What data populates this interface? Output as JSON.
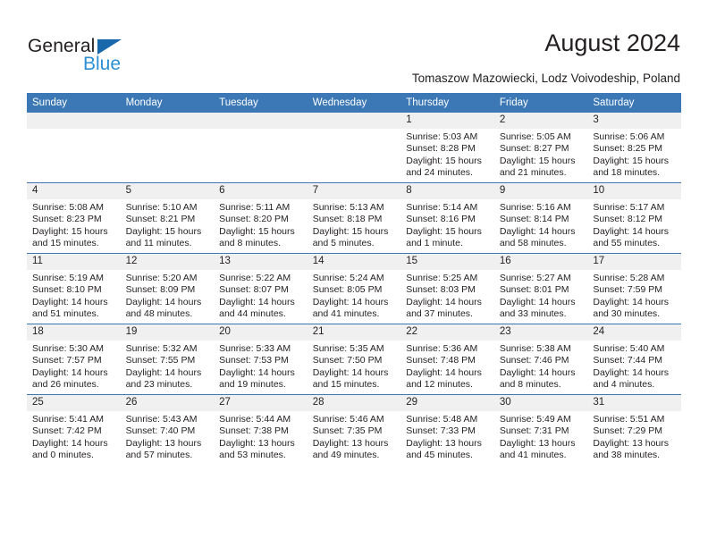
{
  "brand": {
    "name_dark": "General",
    "name_light": "Blue",
    "triangle_color": "#1868ab",
    "light_color": "#2a8fd4"
  },
  "header": {
    "title": "August 2024",
    "subtitle": "Tomaszow Mazowiecki, Lodz Voivodeship, Poland"
  },
  "theme": {
    "header_blue": "#3b78b5",
    "daynum_bg": "#f0f0f0",
    "text": "#231f20"
  },
  "calendar": {
    "weekday_headers": [
      "Sunday",
      "Monday",
      "Tuesday",
      "Wednesday",
      "Thursday",
      "Friday",
      "Saturday"
    ],
    "weeks": [
      [
        {
          "day": "",
          "lines": []
        },
        {
          "day": "",
          "lines": []
        },
        {
          "day": "",
          "lines": []
        },
        {
          "day": "",
          "lines": []
        },
        {
          "day": "1",
          "lines": [
            "Sunrise: 5:03 AM",
            "Sunset: 8:28 PM",
            "Daylight: 15 hours",
            "and 24 minutes."
          ]
        },
        {
          "day": "2",
          "lines": [
            "Sunrise: 5:05 AM",
            "Sunset: 8:27 PM",
            "Daylight: 15 hours",
            "and 21 minutes."
          ]
        },
        {
          "day": "3",
          "lines": [
            "Sunrise: 5:06 AM",
            "Sunset: 8:25 PM",
            "Daylight: 15 hours",
            "and 18 minutes."
          ]
        }
      ],
      [
        {
          "day": "4",
          "lines": [
            "Sunrise: 5:08 AM",
            "Sunset: 8:23 PM",
            "Daylight: 15 hours",
            "and 15 minutes."
          ]
        },
        {
          "day": "5",
          "lines": [
            "Sunrise: 5:10 AM",
            "Sunset: 8:21 PM",
            "Daylight: 15 hours",
            "and 11 minutes."
          ]
        },
        {
          "day": "6",
          "lines": [
            "Sunrise: 5:11 AM",
            "Sunset: 8:20 PM",
            "Daylight: 15 hours",
            "and 8 minutes."
          ]
        },
        {
          "day": "7",
          "lines": [
            "Sunrise: 5:13 AM",
            "Sunset: 8:18 PM",
            "Daylight: 15 hours",
            "and 5 minutes."
          ]
        },
        {
          "day": "8",
          "lines": [
            "Sunrise: 5:14 AM",
            "Sunset: 8:16 PM",
            "Daylight: 15 hours",
            "and 1 minute."
          ]
        },
        {
          "day": "9",
          "lines": [
            "Sunrise: 5:16 AM",
            "Sunset: 8:14 PM",
            "Daylight: 14 hours",
            "and 58 minutes."
          ]
        },
        {
          "day": "10",
          "lines": [
            "Sunrise: 5:17 AM",
            "Sunset: 8:12 PM",
            "Daylight: 14 hours",
            "and 55 minutes."
          ]
        }
      ],
      [
        {
          "day": "11",
          "lines": [
            "Sunrise: 5:19 AM",
            "Sunset: 8:10 PM",
            "Daylight: 14 hours",
            "and 51 minutes."
          ]
        },
        {
          "day": "12",
          "lines": [
            "Sunrise: 5:20 AM",
            "Sunset: 8:09 PM",
            "Daylight: 14 hours",
            "and 48 minutes."
          ]
        },
        {
          "day": "13",
          "lines": [
            "Sunrise: 5:22 AM",
            "Sunset: 8:07 PM",
            "Daylight: 14 hours",
            "and 44 minutes."
          ]
        },
        {
          "day": "14",
          "lines": [
            "Sunrise: 5:24 AM",
            "Sunset: 8:05 PM",
            "Daylight: 14 hours",
            "and 41 minutes."
          ]
        },
        {
          "day": "15",
          "lines": [
            "Sunrise: 5:25 AM",
            "Sunset: 8:03 PM",
            "Daylight: 14 hours",
            "and 37 minutes."
          ]
        },
        {
          "day": "16",
          "lines": [
            "Sunrise: 5:27 AM",
            "Sunset: 8:01 PM",
            "Daylight: 14 hours",
            "and 33 minutes."
          ]
        },
        {
          "day": "17",
          "lines": [
            "Sunrise: 5:28 AM",
            "Sunset: 7:59 PM",
            "Daylight: 14 hours",
            "and 30 minutes."
          ]
        }
      ],
      [
        {
          "day": "18",
          "lines": [
            "Sunrise: 5:30 AM",
            "Sunset: 7:57 PM",
            "Daylight: 14 hours",
            "and 26 minutes."
          ]
        },
        {
          "day": "19",
          "lines": [
            "Sunrise: 5:32 AM",
            "Sunset: 7:55 PM",
            "Daylight: 14 hours",
            "and 23 minutes."
          ]
        },
        {
          "day": "20",
          "lines": [
            "Sunrise: 5:33 AM",
            "Sunset: 7:53 PM",
            "Daylight: 14 hours",
            "and 19 minutes."
          ]
        },
        {
          "day": "21",
          "lines": [
            "Sunrise: 5:35 AM",
            "Sunset: 7:50 PM",
            "Daylight: 14 hours",
            "and 15 minutes."
          ]
        },
        {
          "day": "22",
          "lines": [
            "Sunrise: 5:36 AM",
            "Sunset: 7:48 PM",
            "Daylight: 14 hours",
            "and 12 minutes."
          ]
        },
        {
          "day": "23",
          "lines": [
            "Sunrise: 5:38 AM",
            "Sunset: 7:46 PM",
            "Daylight: 14 hours",
            "and 8 minutes."
          ]
        },
        {
          "day": "24",
          "lines": [
            "Sunrise: 5:40 AM",
            "Sunset: 7:44 PM",
            "Daylight: 14 hours",
            "and 4 minutes."
          ]
        }
      ],
      [
        {
          "day": "25",
          "lines": [
            "Sunrise: 5:41 AM",
            "Sunset: 7:42 PM",
            "Daylight: 14 hours",
            "and 0 minutes."
          ]
        },
        {
          "day": "26",
          "lines": [
            "Sunrise: 5:43 AM",
            "Sunset: 7:40 PM",
            "Daylight: 13 hours",
            "and 57 minutes."
          ]
        },
        {
          "day": "27",
          "lines": [
            "Sunrise: 5:44 AM",
            "Sunset: 7:38 PM",
            "Daylight: 13 hours",
            "and 53 minutes."
          ]
        },
        {
          "day": "28",
          "lines": [
            "Sunrise: 5:46 AM",
            "Sunset: 7:35 PM",
            "Daylight: 13 hours",
            "and 49 minutes."
          ]
        },
        {
          "day": "29",
          "lines": [
            "Sunrise: 5:48 AM",
            "Sunset: 7:33 PM",
            "Daylight: 13 hours",
            "and 45 minutes."
          ]
        },
        {
          "day": "30",
          "lines": [
            "Sunrise: 5:49 AM",
            "Sunset: 7:31 PM",
            "Daylight: 13 hours",
            "and 41 minutes."
          ]
        },
        {
          "day": "31",
          "lines": [
            "Sunrise: 5:51 AM",
            "Sunset: 7:29 PM",
            "Daylight: 13 hours",
            "and 38 minutes."
          ]
        }
      ]
    ]
  }
}
